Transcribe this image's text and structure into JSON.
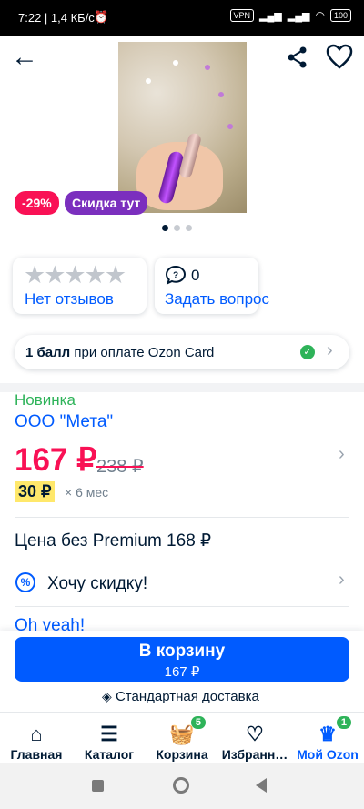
{
  "status": {
    "time": "7:22 | 1,4 КБ/с",
    "vpn": "VPN",
    "battery": "100"
  },
  "badges": {
    "discount": "-29%",
    "promo": "Скидка тут"
  },
  "reviews": {
    "label": "Нет отзывов"
  },
  "questions": {
    "count": "0",
    "label": "Задать вопрос"
  },
  "points": {
    "bold": "1 балл",
    "rest": " при оплате Ozon Card"
  },
  "product": {
    "tag": "Новинка",
    "seller": "ООО \"Мета\""
  },
  "price": {
    "current": "167 ₽",
    "old": "238 ₽",
    "installment": "30 ₽",
    "installment_term": "× 6 мес"
  },
  "premium": {
    "text": "Цена без Premium 168 ₽"
  },
  "want_discount": {
    "text": "Хочу скидку!"
  },
  "oh_yeah": {
    "text": "Oh yeah!"
  },
  "cart_button": {
    "title": "В корзину",
    "price": "167 ₽"
  },
  "delivery": {
    "text": "Стандартная доставка"
  },
  "tabs": [
    {
      "label": "Главная"
    },
    {
      "label": "Каталог"
    },
    {
      "label": "Корзина",
      "count": "5"
    },
    {
      "label": "Избранн…"
    },
    {
      "label": "Мой Ozon",
      "count": "1"
    }
  ],
  "colors": {
    "accent": "#005bff",
    "price": "#f91155",
    "new": "#2eb359",
    "promo": "#7b2fbe"
  }
}
